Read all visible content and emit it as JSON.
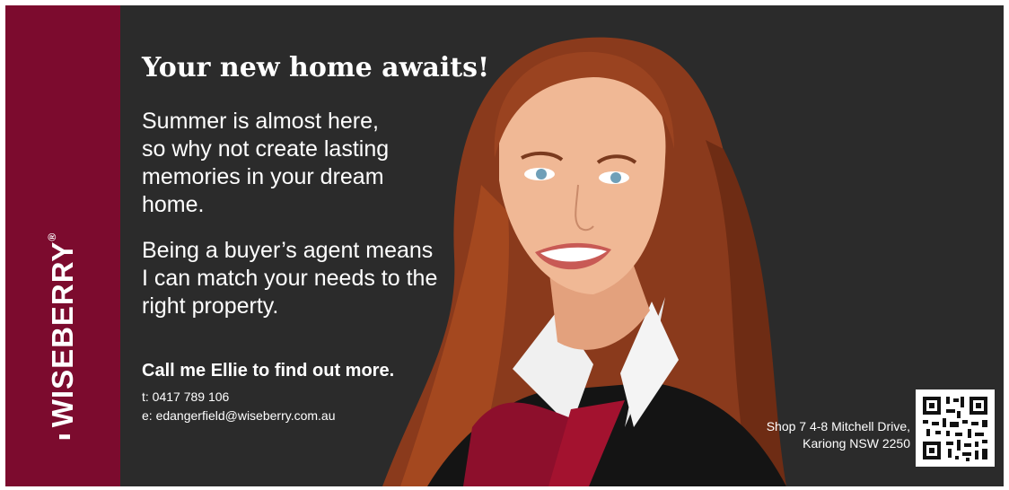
{
  "brand": {
    "name": "WISEBERRY",
    "registered": "®"
  },
  "headline": "Your new home awaits!",
  "paragraphs": {
    "p1": "Summer is almost here,\nso why not create lasting\nmemories in your dream\nhome.",
    "p2": "Being a buyer’s agent means\nI can match your needs to the\nright property."
  },
  "cta": "Call me Ellie to find out more.",
  "contact": {
    "phone": "t: 0417 789 106",
    "email": "e: edangerfield@wiseberry.com.au"
  },
  "address": "Shop 7 4-8 Mitchell Drive,\nKariong  NSW 2250",
  "colors": {
    "brand": "#7c0b2e",
    "background": "#2b2b2b",
    "text": "#ffffff"
  },
  "icons": {
    "qr": "qr-code-icon"
  }
}
